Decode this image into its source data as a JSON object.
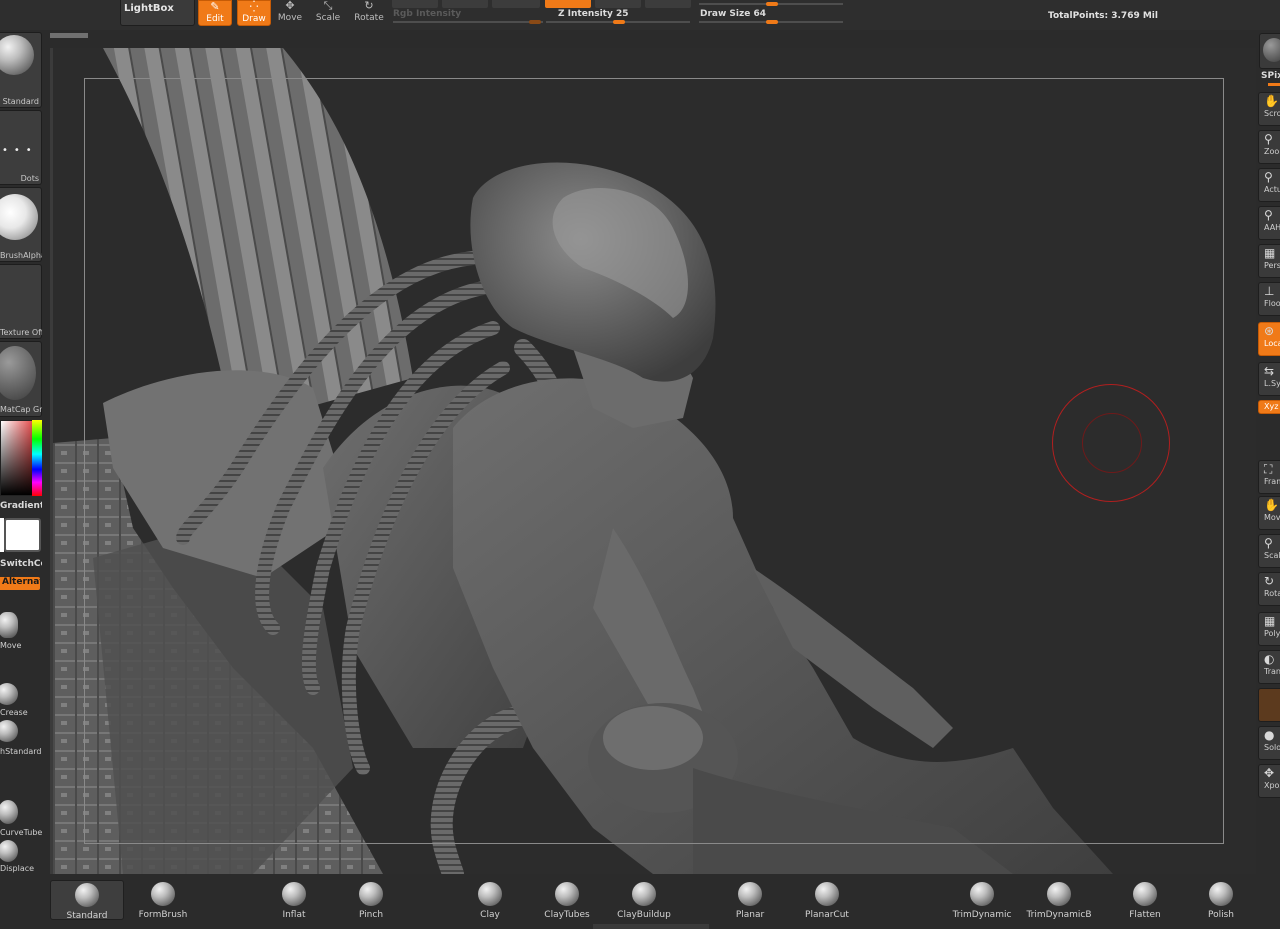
{
  "top": {
    "lightbox_label": "LightBox",
    "tools": [
      {
        "label": "Edit",
        "glyph": "✎"
      },
      {
        "label": "Draw",
        "glyph": "⁛"
      },
      {
        "label": "Move",
        "glyph": "✥"
      },
      {
        "label": "Scale",
        "glyph": "⤡"
      },
      {
        "label": "Rotate",
        "glyph": "↻"
      }
    ],
    "rgb_intensity_label": "Rgb Intensity",
    "z_intensity_label": "Z Intensity 25",
    "draw_size_label": "Draw Size 64",
    "total_points_label": "TotalPoints: 3.769 Mil",
    "z_intensity_value": 25,
    "draw_size_value": 64
  },
  "left": {
    "thumbs": [
      "Standard",
      "Dots",
      "BrushAlpha",
      "Texture Off",
      "MatCap GreyMe"
    ],
    "gradient_label": "Gradient",
    "switch_color_label": "SwitchColor",
    "alternate_label": "Alternate",
    "brushes": [
      "Move",
      "Crease",
      "hStandard",
      "CurveTube",
      "Displace"
    ]
  },
  "right": {
    "spix_label": "SPix",
    "buttons": [
      {
        "label": "Scroll",
        "glyph": "✋"
      },
      {
        "label": "Zoom",
        "glyph": "⚲"
      },
      {
        "label": "Actual",
        "glyph": "⚲"
      },
      {
        "label": "AAHalf",
        "glyph": "⚲"
      },
      {
        "label": "Persp",
        "glyph": "▦"
      },
      {
        "label": "Floor",
        "glyph": "⊥"
      },
      {
        "label": "Local",
        "glyph": "⊛"
      },
      {
        "label": "L.Sym",
        "glyph": "⇆"
      },
      {
        "label": "Xyz",
        "glyph": "⟲"
      },
      {
        "label": "Frame",
        "glyph": "⛶"
      },
      {
        "label": "Move",
        "glyph": "✋"
      },
      {
        "label": "Scale",
        "glyph": "⚲"
      },
      {
        "label": "Rotate",
        "glyph": "↻"
      },
      {
        "label": "PolyF",
        "glyph": "▦"
      },
      {
        "label": "Transp",
        "glyph": "◐"
      },
      {
        "label": "Solo",
        "glyph": "●"
      },
      {
        "label": "Xpose",
        "glyph": "✥"
      }
    ]
  },
  "bottom": {
    "brushes": [
      "Standard",
      "FormBrush",
      "Inflat",
      "Pinch",
      "Clay",
      "ClayTubes",
      "ClayBuildup",
      "Planar",
      "PlanarCut",
      "TrimDynamic",
      "TrimDynamicB",
      "Flatten",
      "Polish"
    ],
    "selected": "Standard"
  },
  "colors": {
    "accent": "#f07a18",
    "brush_cursor": "#b11f1f",
    "background": "#2c2c2c"
  }
}
